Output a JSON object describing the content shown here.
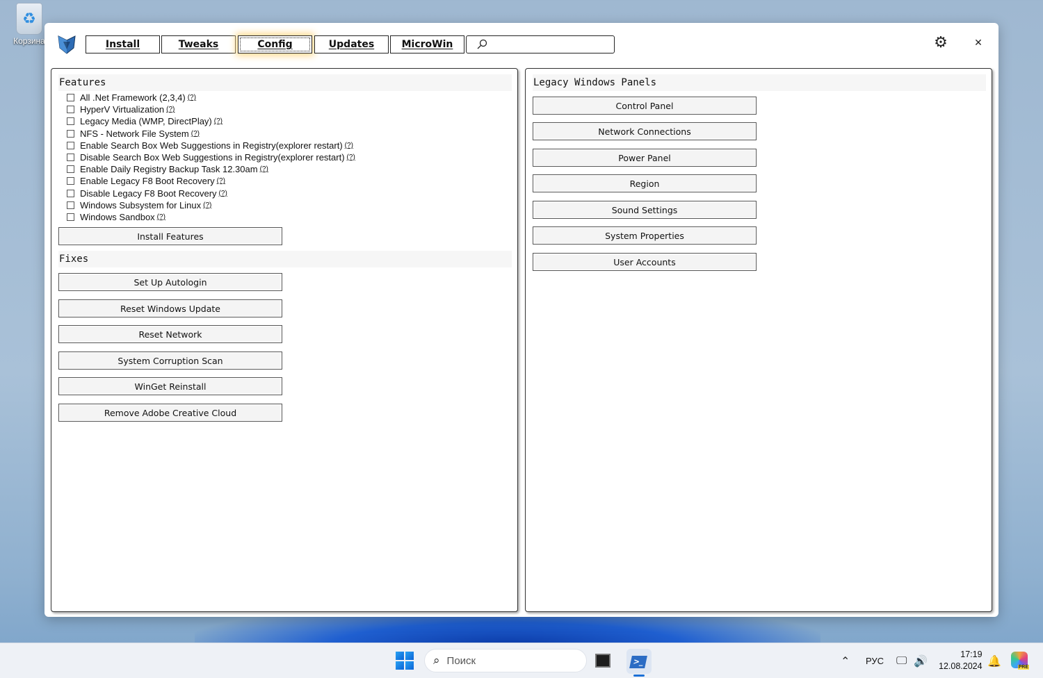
{
  "desktop": {
    "recycle_bin_label": "Корзина"
  },
  "nav": {
    "tabs": [
      {
        "label": "Install"
      },
      {
        "label": "Tweaks"
      },
      {
        "label": "Config"
      },
      {
        "label": "Updates"
      },
      {
        "label": "MicroWin"
      }
    ],
    "active_tab": "Config",
    "search_value": ""
  },
  "features": {
    "title": "Features",
    "items": [
      {
        "label": "All .Net Framework (2,3,4)",
        "help": "(?)"
      },
      {
        "label": "HyperV Virtualization",
        "help": "(?)"
      },
      {
        "label": "Legacy Media (WMP, DirectPlay)",
        "help": "(?)"
      },
      {
        "label": "NFS - Network File System",
        "help": "(?)"
      },
      {
        "label": "Enable Search Box Web Suggestions in Registry(explorer restart)",
        "help": "(?)"
      },
      {
        "label": "Disable Search Box Web Suggestions in Registry(explorer restart)",
        "help": "(?)"
      },
      {
        "label": "Enable Daily Registry Backup Task 12.30am",
        "help": "(?)"
      },
      {
        "label": "Enable Legacy F8 Boot Recovery",
        "help": "(?)"
      },
      {
        "label": "Disable Legacy F8 Boot Recovery",
        "help": "(?)"
      },
      {
        "label": "Windows Subsystem for Linux",
        "help": "(?)"
      },
      {
        "label": "Windows Sandbox",
        "help": "(?)"
      }
    ],
    "install_button": "Install Features"
  },
  "fixes": {
    "title": "Fixes",
    "buttons": [
      "Set Up Autologin",
      "Reset Windows Update",
      "Reset Network",
      "System Corruption Scan",
      "WinGet Reinstall",
      "Remove Adobe Creative Cloud"
    ]
  },
  "legacy_panels": {
    "title": "Legacy Windows Panels",
    "buttons": [
      "Control Panel",
      "Network Connections",
      "Power Panel",
      "Region",
      "Sound Settings",
      "System Properties",
      "User Accounts"
    ]
  },
  "taskbar": {
    "search_label": "Поиск",
    "language": "РУС",
    "time": "17:19",
    "date": "12.08.2024",
    "copilot_badge": "PRE"
  }
}
